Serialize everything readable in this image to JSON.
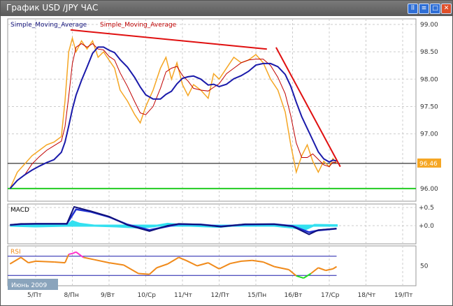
{
  "window": {
    "title": "График USD /JPY  ЧАС",
    "buttons": [
      "pause",
      "restore",
      "maximize",
      "close"
    ]
  },
  "period_badge": "Июнь 2009",
  "colors": {
    "price": "#f5a623",
    "sma_fast": "#c00000",
    "sma_slow": "#1a1aaa",
    "trend": "#e01010",
    "support": "#22cc22",
    "macd": "#10107a",
    "signal": "#2030d0",
    "hist": "#33e0f0",
    "rsi": "#f08a1a",
    "rsi_over": "#ff33cc",
    "rsi_under": "#22dd22"
  },
  "chart_data": [
    {
      "type": "line",
      "title": "USD/JPY hourly",
      "legend": [
        "Simple_Moving_Average",
        "Simple_Moving_Average"
      ],
      "x_ticks": [
        "5/Пт",
        "8/Пн",
        "9/Вт",
        "10/Ср",
        "11/Чт",
        "12/Пт",
        "15/Пн",
        "16/Вт",
        "17/Ср",
        "18/Чт",
        "19/Пт"
      ],
      "y_ticks": [
        "99.00",
        "98.50",
        "98.00",
        "97.50",
        "97.00",
        "96.00"
      ],
      "ylim": [
        95.9,
        99.1
      ],
      "current_price": "96.46",
      "support_level": 96.0,
      "price": [
        [
          -0.7,
          96.0
        ],
        [
          -0.5,
          96.3
        ],
        [
          -0.3,
          96.45
        ],
        [
          -0.1,
          96.6
        ],
        [
          0.1,
          96.7
        ],
        [
          0.3,
          96.8
        ],
        [
          0.5,
          96.85
        ],
        [
          0.7,
          96.95
        ],
        [
          0.8,
          97.6
        ],
        [
          0.9,
          98.5
        ],
        [
          1.0,
          98.75
        ],
        [
          1.1,
          98.5
        ],
        [
          1.25,
          98.7
        ],
        [
          1.4,
          98.55
        ],
        [
          1.55,
          98.7
        ],
        [
          1.7,
          98.4
        ],
        [
          1.85,
          98.5
        ],
        [
          2.0,
          98.35
        ],
        [
          2.15,
          98.2
        ],
        [
          2.3,
          97.8
        ],
        [
          2.5,
          97.6
        ],
        [
          2.7,
          97.35
        ],
        [
          2.85,
          97.2
        ],
        [
          3.0,
          97.5
        ],
        [
          3.2,
          97.8
        ],
        [
          3.4,
          98.2
        ],
        [
          3.55,
          98.4
        ],
        [
          3.7,
          98.0
        ],
        [
          3.85,
          98.3
        ],
        [
          4.0,
          97.9
        ],
        [
          4.15,
          97.7
        ],
        [
          4.3,
          97.9
        ],
        [
          4.5,
          97.8
        ],
        [
          4.7,
          97.65
        ],
        [
          4.85,
          98.1
        ],
        [
          5.0,
          98.0
        ],
        [
          5.2,
          98.2
        ],
        [
          5.4,
          98.4
        ],
        [
          5.6,
          98.3
        ],
        [
          5.8,
          98.35
        ],
        [
          6.0,
          98.45
        ],
        [
          6.2,
          98.3
        ],
        [
          6.4,
          98.0
        ],
        [
          6.6,
          97.8
        ],
        [
          6.8,
          97.4
        ],
        [
          6.95,
          96.8
        ],
        [
          7.1,
          96.3
        ],
        [
          7.25,
          96.6
        ],
        [
          7.4,
          96.8
        ],
        [
          7.55,
          96.5
        ],
        [
          7.7,
          96.3
        ],
        [
          7.85,
          96.5
        ],
        [
          8.0,
          96.4
        ],
        [
          8.1,
          96.55
        ],
        [
          8.2,
          96.46
        ]
      ],
      "trendlines": [
        [
          [
            0.95,
            98.9
          ],
          [
            6.3,
            98.55
          ]
        ],
        [
          [
            6.55,
            98.58
          ],
          [
            8.3,
            96.4
          ]
        ]
      ]
    },
    {
      "type": "line",
      "title": "MACD",
      "y_ticks": [
        "+0.5",
        "+0.0"
      ],
      "ylim": [
        -0.3,
        0.6
      ],
      "macd": [
        [
          -0.7,
          0.02
        ],
        [
          -0.4,
          0.05
        ],
        [
          0,
          0.05
        ],
        [
          0.5,
          0.05
        ],
        [
          0.85,
          0.05
        ],
        [
          1.05,
          0.52
        ],
        [
          1.5,
          0.4
        ],
        [
          2.0,
          0.25
        ],
        [
          2.5,
          0.02
        ],
        [
          3.1,
          -0.15
        ],
        [
          3.6,
          0.0
        ],
        [
          3.9,
          0.05
        ],
        [
          4.5,
          0.03
        ],
        [
          5.05,
          -0.03
        ],
        [
          5.7,
          0.04
        ],
        [
          6.5,
          0.04
        ],
        [
          7.0,
          -0.02
        ],
        [
          7.45,
          -0.24
        ],
        [
          7.7,
          -0.12
        ],
        [
          8.2,
          -0.08
        ]
      ],
      "signal": [
        [
          -0.7,
          0.02
        ],
        [
          -0.4,
          0.04
        ],
        [
          0,
          0.05
        ],
        [
          0.5,
          0.05
        ],
        [
          0.85,
          0.05
        ],
        [
          1.1,
          0.45
        ],
        [
          1.5,
          0.38
        ],
        [
          2.0,
          0.24
        ],
        [
          2.5,
          0.03
        ],
        [
          3.1,
          -0.12
        ],
        [
          3.6,
          -0.02
        ],
        [
          3.9,
          0.04
        ],
        [
          4.5,
          0.03
        ],
        [
          5.05,
          -0.02
        ],
        [
          5.7,
          0.03
        ],
        [
          6.5,
          0.04
        ],
        [
          7.0,
          -0.01
        ],
        [
          7.45,
          -0.18
        ],
        [
          7.7,
          -0.13
        ],
        [
          8.2,
          -0.08
        ]
      ],
      "hist": [
        [
          -0.7,
          0
        ],
        [
          0,
          -0.02
        ],
        [
          0.85,
          0.0
        ],
        [
          1.0,
          0.12
        ],
        [
          1.2,
          0.05
        ],
        [
          1.6,
          0.0
        ],
        [
          2.2,
          -0.02
        ],
        [
          2.8,
          -0.05
        ],
        [
          3.2,
          -0.02
        ],
        [
          3.6,
          0.05
        ],
        [
          4.2,
          0.0
        ],
        [
          5.0,
          -0.03
        ],
        [
          5.6,
          0.02
        ],
        [
          6.5,
          0.0
        ],
        [
          7.0,
          -0.05
        ],
        [
          7.35,
          -0.1
        ],
        [
          7.6,
          0.02
        ],
        [
          8.2,
          0.01
        ]
      ]
    },
    {
      "type": "line",
      "title": "RSI",
      "y_ticks": [
        "50"
      ],
      "ylim": [
        0,
        100
      ],
      "levels": [
        75,
        25
      ],
      "rsi": [
        [
          -0.7,
          55
        ],
        [
          -0.4,
          72
        ],
        [
          -0.2,
          58
        ],
        [
          0,
          62
        ],
        [
          0.5,
          60
        ],
        [
          0.8,
          58
        ],
        [
          0.9,
          80
        ],
        [
          1.0,
          82
        ],
        [
          1.1,
          86
        ],
        [
          1.3,
          72
        ],
        [
          1.6,
          66
        ],
        [
          2.0,
          58
        ],
        [
          2.4,
          52
        ],
        [
          2.8,
          30
        ],
        [
          3.1,
          28
        ],
        [
          3.3,
          45
        ],
        [
          3.6,
          55
        ],
        [
          3.9,
          72
        ],
        [
          4.1,
          64
        ],
        [
          4.4,
          50
        ],
        [
          4.7,
          58
        ],
        [
          5.0,
          42
        ],
        [
          5.3,
          56
        ],
        [
          5.6,
          62
        ],
        [
          5.9,
          64
        ],
        [
          6.2,
          60
        ],
        [
          6.5,
          48
        ],
        [
          6.9,
          40
        ],
        [
          7.1,
          24
        ],
        [
          7.3,
          18
        ],
        [
          7.5,
          30
        ],
        [
          7.7,
          45
        ],
        [
          7.9,
          38
        ],
        [
          8.1,
          42
        ],
        [
          8.2,
          48
        ]
      ]
    }
  ]
}
